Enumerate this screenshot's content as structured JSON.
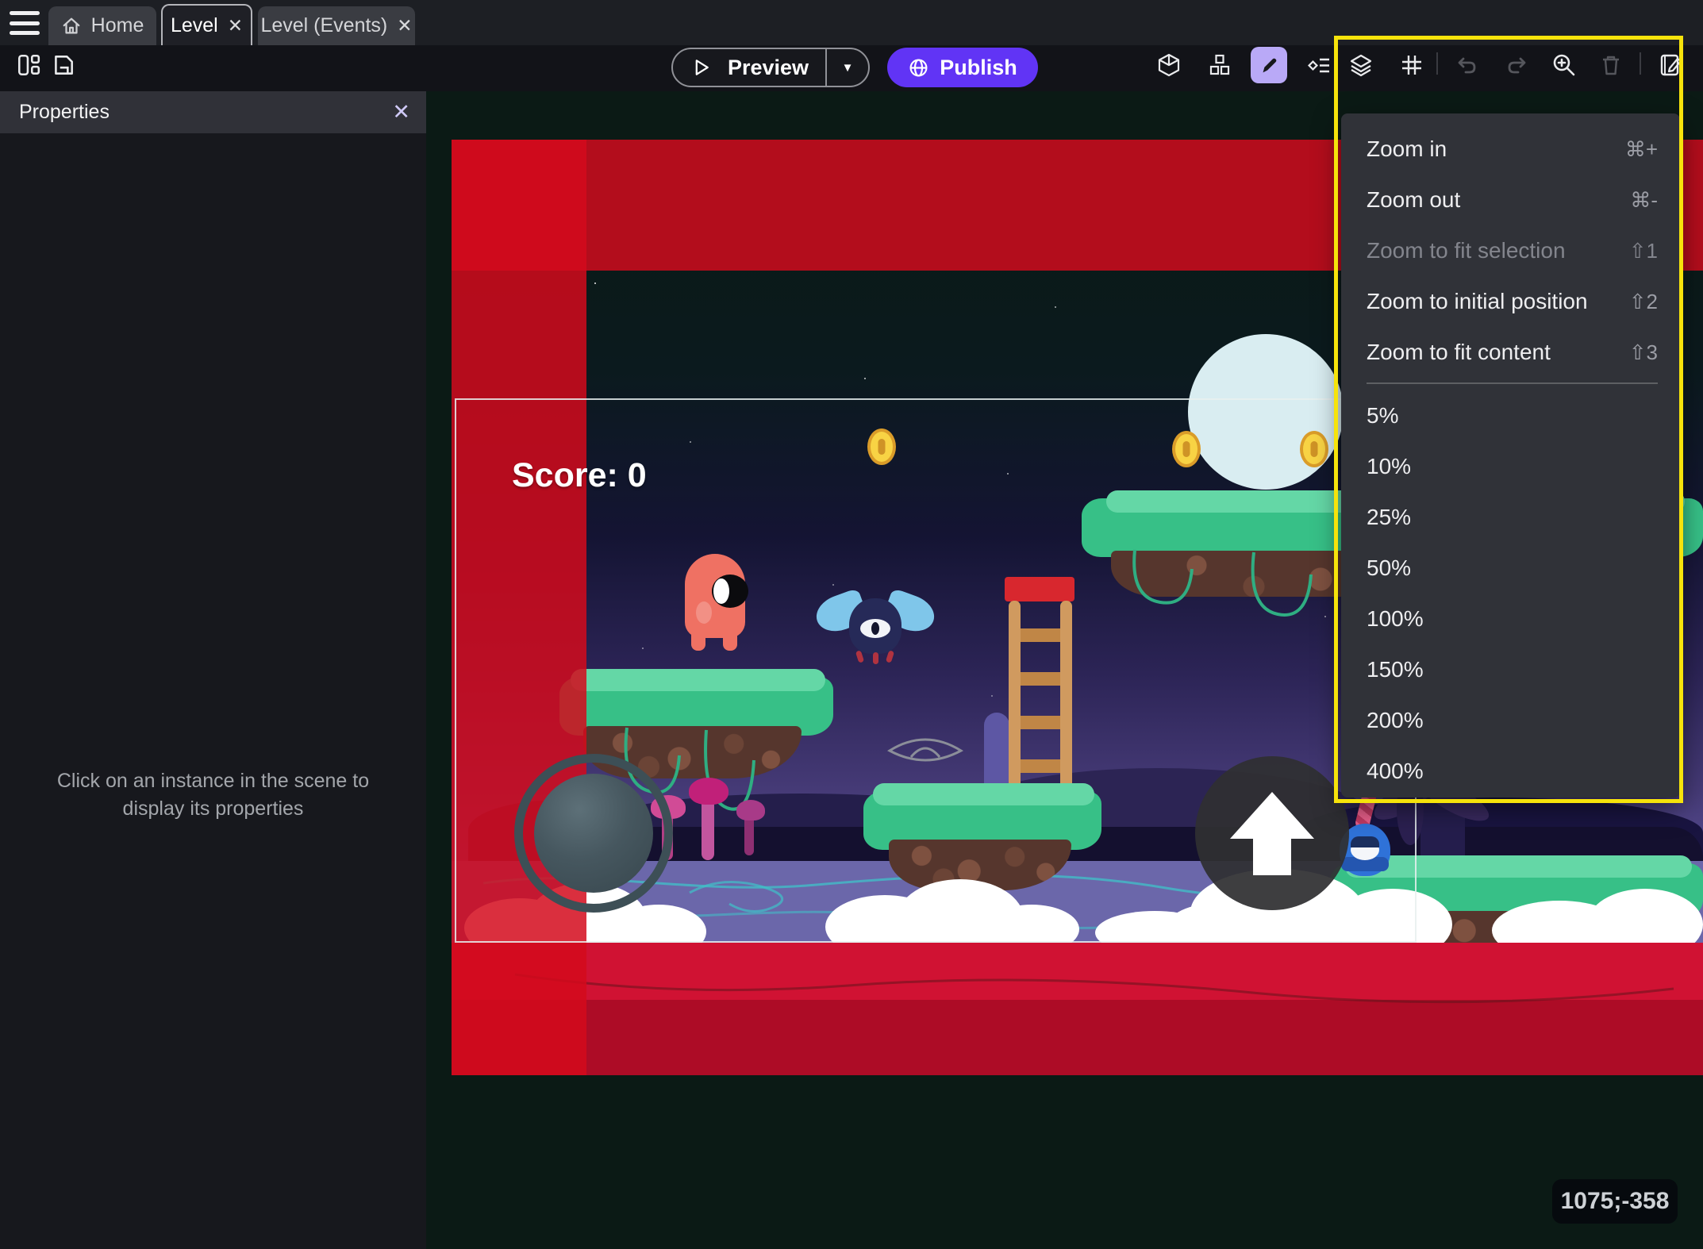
{
  "window": {
    "tabs": [
      {
        "label": "Home"
      },
      {
        "label": "Level"
      },
      {
        "label": "Level (Events)"
      }
    ]
  },
  "glyphs": {
    "close": "✕",
    "caret_down": "▼"
  },
  "toolbar": {
    "preview_label": "Preview",
    "publish_label": "Publish"
  },
  "properties_panel": {
    "title": "Properties",
    "empty_hint": "Click on an instance in the scene to display its properties"
  },
  "zoom_menu": {
    "items": [
      {
        "label": "Zoom in",
        "shortcut": "⌘+"
      },
      {
        "label": "Zoom out",
        "shortcut": "⌘-"
      },
      {
        "label": "Zoom to fit selection",
        "shortcut": "⇧1",
        "disabled": true
      },
      {
        "label": "Zoom to initial position",
        "shortcut": "⇧2"
      },
      {
        "label": "Zoom to fit content",
        "shortcut": "⇧3"
      }
    ],
    "levels": [
      "5%",
      "10%",
      "25%",
      "50%",
      "100%",
      "150%",
      "200%",
      "400%"
    ]
  },
  "scene": {
    "score": "Score: 0"
  },
  "status": {
    "coordinates": "1075;-358"
  },
  "icons": [
    "menu-icon",
    "home-icon",
    "close-icon",
    "layout-icon",
    "save-icon",
    "play-icon",
    "globe-icon",
    "cube-icon",
    "objects-icon",
    "pencil-icon",
    "instances-list-icon",
    "layers-icon",
    "grid-icon",
    "undo-icon",
    "redo-icon",
    "zoom-in-icon",
    "trash-icon",
    "edit-scene-icon"
  ],
  "colors": {
    "accent_purple": "#6134f5",
    "tool_highlight": "#b9a9f7",
    "selection_yellow": "#f6e30b",
    "menu_bg": "#303238",
    "red_band": "#b30d1c",
    "canvas_bg": "#0b1a15"
  }
}
